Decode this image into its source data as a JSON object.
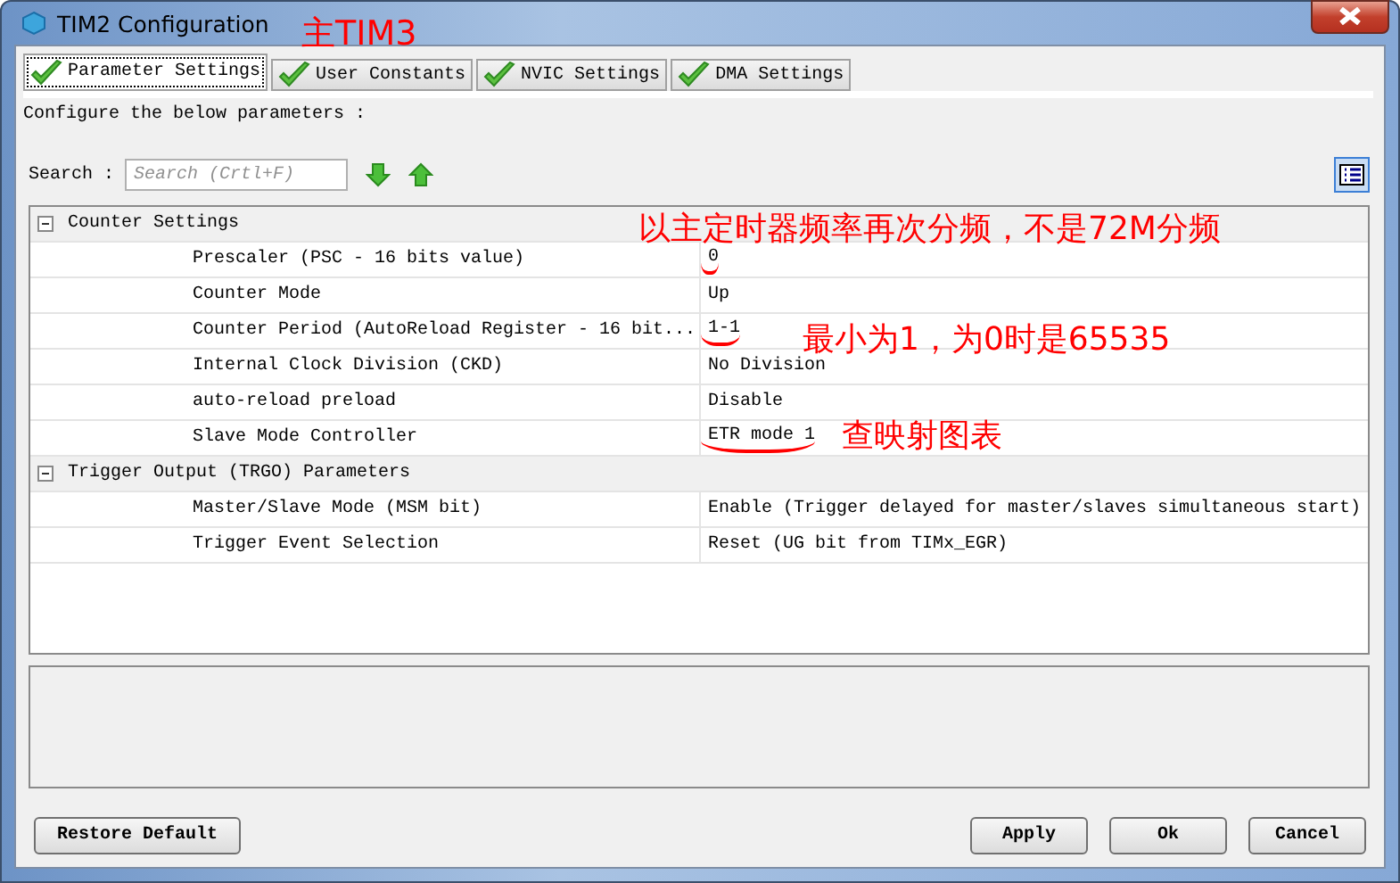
{
  "window": {
    "title": "TIM2 Configuration"
  },
  "tabs": [
    {
      "label": "Parameter Settings",
      "selected": true
    },
    {
      "label": "User Constants",
      "selected": false
    },
    {
      "label": "NVIC Settings",
      "selected": false
    },
    {
      "label": "DMA Settings",
      "selected": false
    }
  ],
  "intro": "Configure the below parameters :",
  "search": {
    "label": "Search :",
    "placeholder": "Search (Crtl+F)"
  },
  "groups": [
    {
      "name": "Counter Settings",
      "expanded": true,
      "children": [
        {
          "name": "Prescaler (PSC - 16 bits value)",
          "value": "0",
          "underlined": true
        },
        {
          "name": "Counter Mode",
          "value": "Up",
          "underlined": false
        },
        {
          "name": "Counter Period (AutoReload Register - 16 bit...",
          "value": "1-1",
          "underlined": true
        },
        {
          "name": "Internal Clock Division (CKD)",
          "value": "No Division",
          "underlined": false
        },
        {
          "name": "auto-reload preload",
          "value": "Disable",
          "underlined": false
        },
        {
          "name": "Slave Mode Controller",
          "value": "ETR mode 1",
          "underlined": true
        }
      ]
    },
    {
      "name": "Trigger Output (TRGO) Parameters",
      "expanded": true,
      "children": [
        {
          "name": "Master/Slave Mode (MSM bit)",
          "value": "Enable (Trigger delayed for master/slaves simultaneous start)",
          "underlined": false
        },
        {
          "name": "Trigger Event Selection",
          "value": "Reset (UG bit from TIMx_EGR)",
          "underlined": false
        }
      ]
    }
  ],
  "buttons": [
    {
      "label": "Restore Default",
      "kind": "left"
    },
    {
      "label": "Apply",
      "kind": "right"
    },
    {
      "label": "Ok",
      "kind": "right"
    },
    {
      "label": "Cancel",
      "kind": "right"
    }
  ],
  "annotations": [
    {
      "text": "主TIM3",
      "kind": "title"
    },
    {
      "text": "以主定时器频率再次分频，不是72M分频",
      "kind": "prescaler"
    },
    {
      "text": "最小为1，为0时是65535",
      "kind": "period"
    },
    {
      "text": "查映射图表",
      "kind": "slave"
    }
  ]
}
